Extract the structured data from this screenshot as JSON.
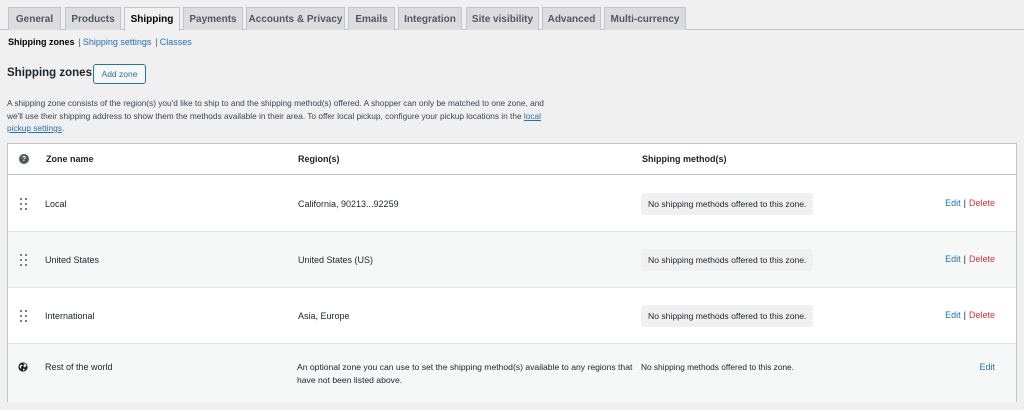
{
  "tabs": [
    {
      "label": "General",
      "active": false
    },
    {
      "label": "Products",
      "active": false
    },
    {
      "label": "Shipping",
      "active": true
    },
    {
      "label": "Payments",
      "active": false
    },
    {
      "label": "Accounts & Privacy",
      "active": false
    },
    {
      "label": "Emails",
      "active": false
    },
    {
      "label": "Integration",
      "active": false
    },
    {
      "label": "Site visibility",
      "active": false
    },
    {
      "label": "Advanced",
      "active": false
    },
    {
      "label": "Multi-currency",
      "active": false
    }
  ],
  "subnav": {
    "current": "Shipping zones",
    "separator": "|",
    "links": [
      "Shipping settings",
      "Classes"
    ]
  },
  "section": {
    "title": "Shipping zones",
    "add_button": "Add zone",
    "description_part1": "A shipping zone consists of the region(s) you'd like to ship to and the shipping method(s) offered. A shopper can only be matched to one zone, and we'll use their shipping address to show them the methods available in their area. To offer local pickup, configure your pickup locations in the ",
    "description_link": "local pickup settings",
    "description_part2": "."
  },
  "table": {
    "help_icon": "help-icon",
    "columns": [
      "Zone name",
      "Region(s)",
      "Shipping method(s)"
    ],
    "rows": [
      {
        "zone": "Local",
        "region": "California, 90213...92259",
        "method": "No shipping methods offered to this zone.",
        "edit": "Edit",
        "separator": "|",
        "delete": "Delete"
      },
      {
        "zone": "United States",
        "region": "United States (US)",
        "method": "No shipping methods offered to this zone.",
        "edit": "Edit",
        "separator": "|",
        "delete": "Delete"
      },
      {
        "zone": "International",
        "region": "Asia, Europe",
        "method": "No shipping methods offered to this zone.",
        "edit": "Edit",
        "separator": "|",
        "delete": "Delete"
      }
    ],
    "rest": {
      "icon": "globe-icon",
      "zone": "Rest of the world",
      "region": "An optional zone you can use to set the shipping method(s) available to any regions that have not been listed above.",
      "method": "No shipping methods offered to this zone.",
      "edit": "Edit"
    }
  },
  "colors": {
    "link": "#2271b1",
    "delete": "#d63638",
    "background": "#f0f0f1",
    "tab_inactive": "#dcdcde"
  }
}
